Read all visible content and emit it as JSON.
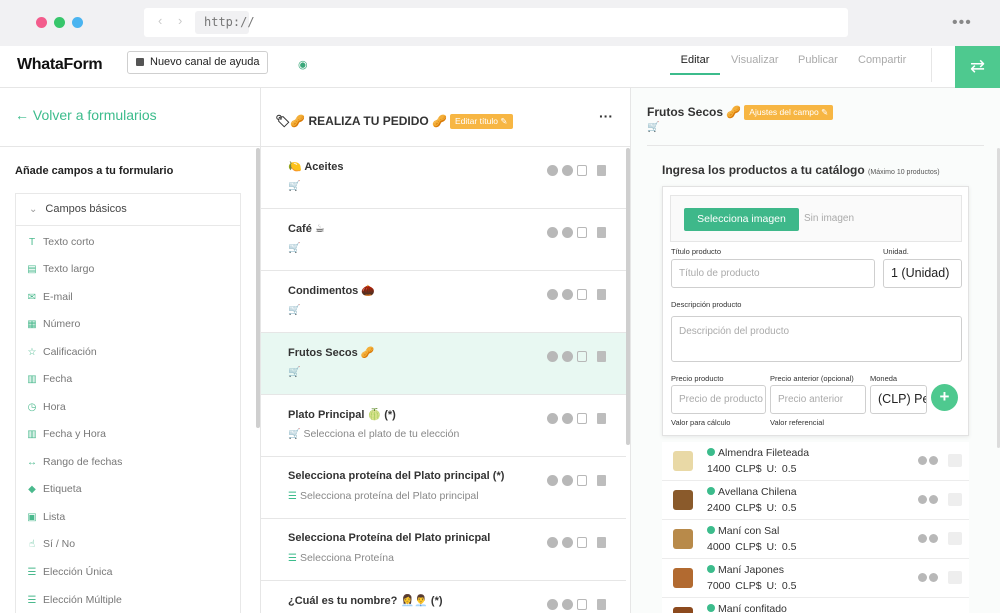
{
  "browser": {
    "url": "http://",
    "nav_arrows": "‹ ›",
    "menu": "•••"
  },
  "header": {
    "logo": "WhataForm",
    "help_button": "Nuevo canal de ayuda",
    "tabs": [
      "Editar",
      "Visualizar",
      "Publicar",
      "Compartir"
    ],
    "active_tab": "Editar",
    "swap_icon": "⇄",
    "gauge_icon": "◉"
  },
  "left": {
    "back_link": "← Volver a formularios",
    "add_title": "Añade campos a tu formulario",
    "group_title": "Campos básicos",
    "group_chevron": "⌄",
    "fields": [
      {
        "icon": "T",
        "label": "Texto corto"
      },
      {
        "icon": "▤",
        "label": "Texto largo"
      },
      {
        "icon": "✉",
        "label": "E-mail"
      },
      {
        "icon": "▦",
        "label": "Número"
      },
      {
        "icon": "☆",
        "label": "Calificación"
      },
      {
        "icon": "▥",
        "label": "Fecha"
      },
      {
        "icon": "◷",
        "label": "Hora"
      },
      {
        "icon": "▥",
        "label": "Fecha y Hora"
      },
      {
        "icon": "↔",
        "label": "Rango de fechas"
      },
      {
        "icon": "◆",
        "label": "Etiqueta"
      },
      {
        "icon": "▣",
        "label": "Lista"
      },
      {
        "icon": "☝",
        "label": "Sí / No"
      },
      {
        "icon": "☰",
        "label": "Elección Única"
      },
      {
        "icon": "☰",
        "label": "Elección Múltiple"
      }
    ]
  },
  "middle": {
    "form_title": "🏷🥜 REALIZA TU PEDIDO 🥜",
    "edit_title_badge": "Editar título ✎",
    "more": "···",
    "questions": [
      {
        "title": "🍋 Aceites",
        "sub_icon": "🛒",
        "sub": ""
      },
      {
        "title": "Café ☕",
        "sub_icon": "🛒",
        "sub": ""
      },
      {
        "title": "Condimentos 🌰",
        "sub_icon": "🛒",
        "sub": ""
      },
      {
        "title": "Frutos Secos 🥜",
        "sub_icon": "🛒",
        "sub": ""
      },
      {
        "title": "Plato Principal 🍈 (*)",
        "sub_icon": "🛒",
        "sub": "Selecciona el plato de tu elección"
      },
      {
        "title": "Selecciona proteína del Plato principal (*)",
        "sub_icon": "☰",
        "sub": "Selecciona proteína del Plato principal"
      },
      {
        "title": "Selecciona Proteína del Plato prinicpal",
        "sub_icon": "☰",
        "sub": "Selecciona Proteína"
      },
      {
        "title": "¿Cuál es tu nombre? 👩‍💼👨‍💼 (*)",
        "sub_icon": "",
        "sub": ""
      }
    ]
  },
  "right": {
    "field_title": "Frutos Secos 🥜",
    "settings_badge": "Ajustes del campo ✎",
    "cart_icon": "🛒",
    "catalog_title": "Ingresa los productos a tu catálogo",
    "catalog_note": "(Máximo 10 productos)",
    "select_image": "Selecciona imagen",
    "no_image": "Sin imagen",
    "product_title_label": "Título producto",
    "product_title_placeholder": "Título de producto",
    "unit_label": "Unidad.",
    "unit_value": "1 (Unidad)",
    "description_label": "Descripción producto",
    "description_placeholder": "Descripción del producto",
    "price_label": "Precio producto",
    "price_placeholder": "Precio de producto",
    "old_price_label": "Precio anterior (opcional)",
    "old_price_placeholder": "Precio anterior",
    "currency_label": "Moneda",
    "currency_value": "(CLP) Peso",
    "calc_note": "Valor para cálculo",
    "ref_note": "Valor referencial",
    "add_icon": "+",
    "products": [
      {
        "name": "Almendra Fileteada",
        "price": "1400 CLP$",
        "unit": "U: 0.5",
        "color": "#e9d9a6"
      },
      {
        "name": "Avellana Chilena",
        "price": "2400 CLP$",
        "unit": "U: 0.5",
        "color": "#8a5a2b"
      },
      {
        "name": "Maní con Sal",
        "price": "4000 CLP$",
        "unit": "U: 0.5",
        "color": "#b88a4a"
      },
      {
        "name": "Maní Japones",
        "price": "7000 CLP$",
        "unit": "U: 0.5",
        "color": "#b26a30"
      },
      {
        "name": "Maní confitado",
        "price": "",
        "unit": "",
        "color": "#8c4a1e"
      }
    ]
  }
}
